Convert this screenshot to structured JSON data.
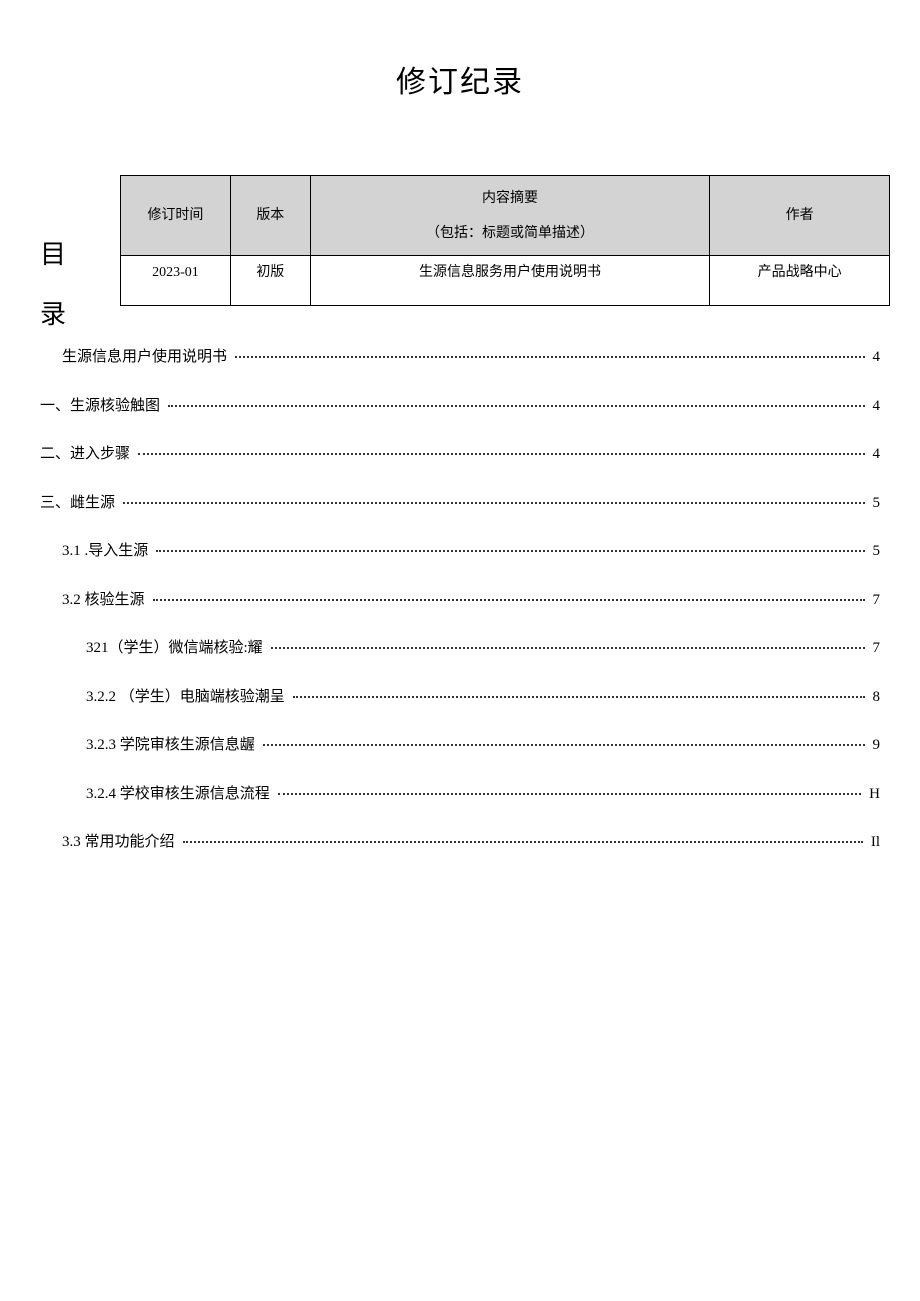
{
  "title": "修订纪录",
  "vertical_label": {
    "c1": "目",
    "c2": "录"
  },
  "table": {
    "headers": {
      "time": "修订时间",
      "version": "版本",
      "summary_line1": "内容摘要",
      "summary_line2": "（包括：标题或简单描述）",
      "author": "作者"
    },
    "row": {
      "time": "2023-01",
      "version": "初版",
      "summary": "生源信息服务用户使用说明书",
      "author": "产品战略中心"
    }
  },
  "toc": {
    "items": [
      {
        "indent": 1,
        "label": "生源信息用户使用说明书",
        "page": "4"
      },
      {
        "indent": 0,
        "label": "一、生源核验触图",
        "page": "4"
      },
      {
        "indent": 0,
        "label": "二、进入步骤",
        "page": "4"
      },
      {
        "indent": 0,
        "label": "三、雌生源",
        "page": "5"
      },
      {
        "indent": 2,
        "label": "3.1   .导入生源",
        "page": "5"
      },
      {
        "indent": 2,
        "label": "3.2   核验生源",
        "page": "7"
      },
      {
        "indent": 3,
        "label": "321（学生）微信端核验:耀",
        "page": "7"
      },
      {
        "indent": 3,
        "label": "3.2.2   （学生）电脑端核验潮呈",
        "page": "8"
      },
      {
        "indent": 3,
        "label": "3.2.3   学院审核生源信息龌",
        "page": "9"
      },
      {
        "indent": 3,
        "label": "3.2.4   学校审核生源信息流程",
        "page": "H"
      },
      {
        "indent": 2,
        "label": "3.3   常用功能介绍",
        "page": "Il"
      }
    ]
  }
}
